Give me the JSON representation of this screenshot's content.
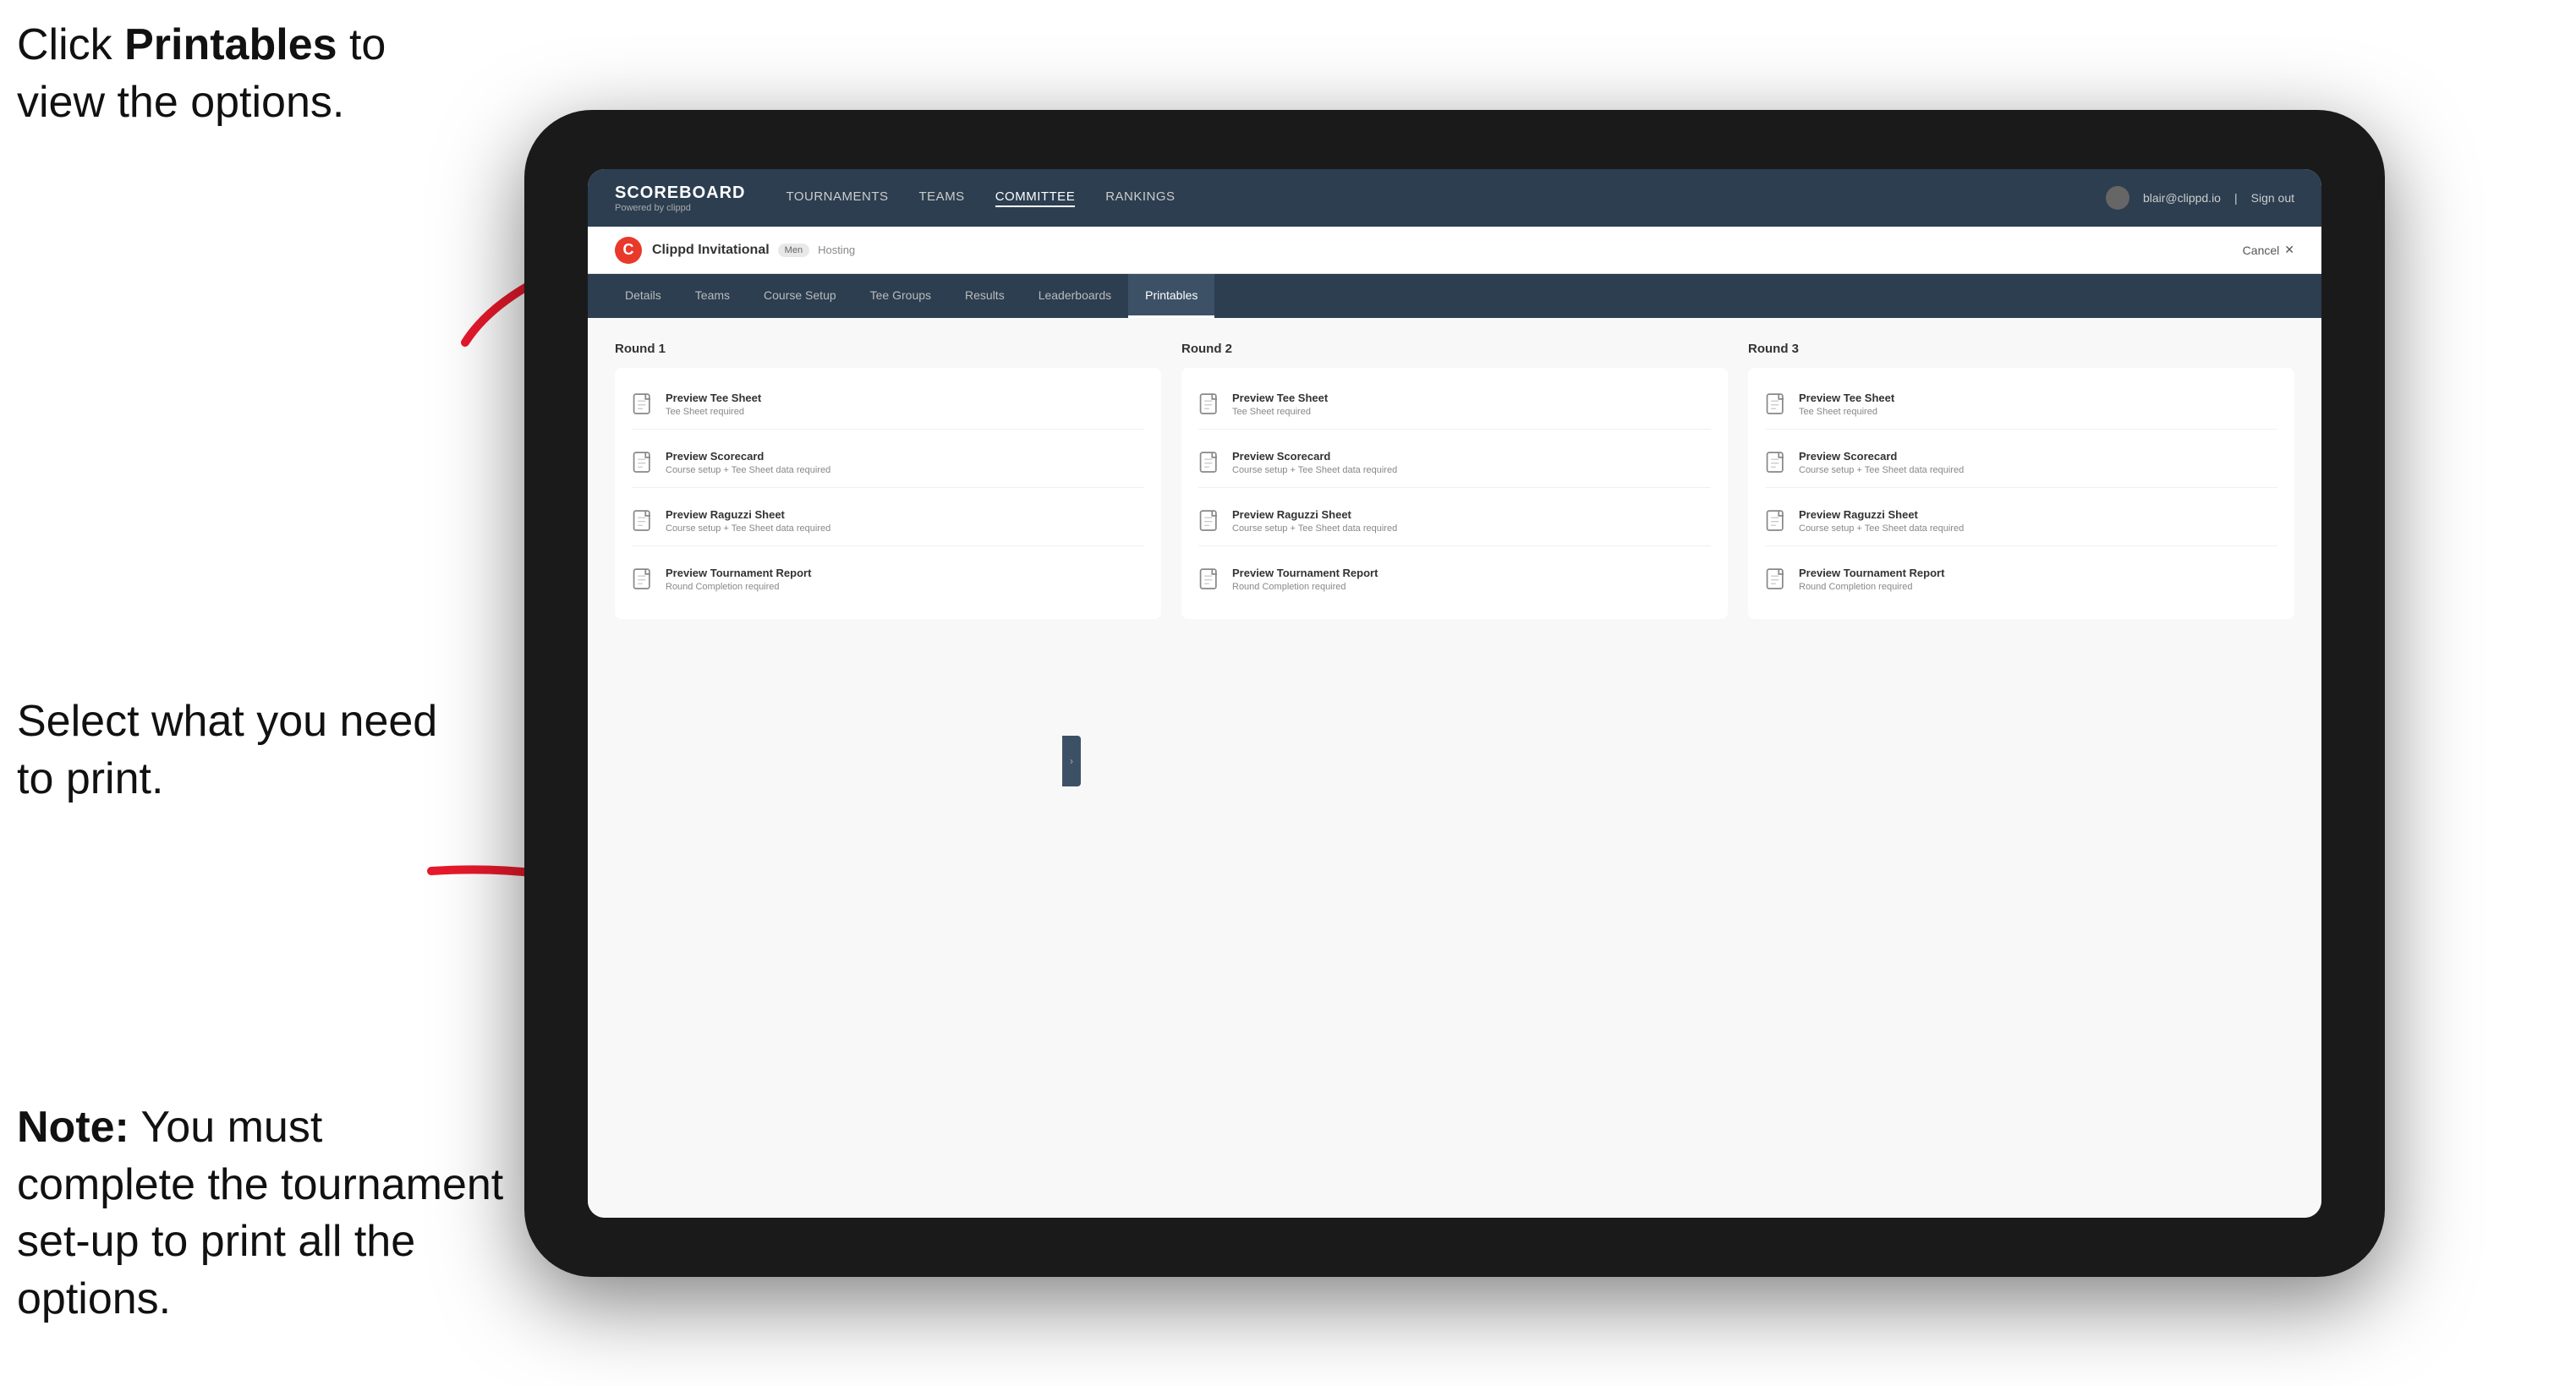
{
  "annotations": {
    "top": "Click Printables to view the options.",
    "top_bold": "Printables",
    "middle": "Select what you need to print.",
    "bottom_note_bold": "Note:",
    "bottom_note": " You must complete the tournament set-up to print all the options."
  },
  "nav": {
    "logo_title": "SCOREBOARD",
    "logo_sub": "Powered by clippd",
    "links": [
      {
        "label": "TOURNAMENTS",
        "active": false
      },
      {
        "label": "TEAMS",
        "active": false
      },
      {
        "label": "COMMITTEE",
        "active": false
      },
      {
        "label": "RANKINGS",
        "active": false
      }
    ],
    "user_email": "blair@clippd.io",
    "sign_out": "Sign out",
    "separator": "|"
  },
  "tournament": {
    "logo_letter": "C",
    "name": "Clippd Invitational",
    "badge": "Men",
    "status": "Hosting",
    "cancel_label": "Cancel"
  },
  "sub_tabs": [
    {
      "label": "Details",
      "active": false
    },
    {
      "label": "Teams",
      "active": false
    },
    {
      "label": "Course Setup",
      "active": false
    },
    {
      "label": "Tee Groups",
      "active": false
    },
    {
      "label": "Results",
      "active": false
    },
    {
      "label": "Leaderboards",
      "active": false
    },
    {
      "label": "Printables",
      "active": true
    }
  ],
  "rounds": [
    {
      "title": "Round 1",
      "items": [
        {
          "label": "Preview Tee Sheet",
          "sub": "Tee Sheet required"
        },
        {
          "label": "Preview Scorecard",
          "sub": "Course setup + Tee Sheet data required"
        },
        {
          "label": "Preview Raguzzi Sheet",
          "sub": "Course setup + Tee Sheet data required"
        },
        {
          "label": "Preview Tournament Report",
          "sub": "Round Completion required"
        }
      ]
    },
    {
      "title": "Round 2",
      "items": [
        {
          "label": "Preview Tee Sheet",
          "sub": "Tee Sheet required"
        },
        {
          "label": "Preview Scorecard",
          "sub": "Course setup + Tee Sheet data required"
        },
        {
          "label": "Preview Raguzzi Sheet",
          "sub": "Course setup + Tee Sheet data required"
        },
        {
          "label": "Preview Tournament Report",
          "sub": "Round Completion required"
        }
      ]
    },
    {
      "title": "Round 3",
      "items": [
        {
          "label": "Preview Tee Sheet",
          "sub": "Tee Sheet required"
        },
        {
          "label": "Preview Scorecard",
          "sub": "Course setup + Tee Sheet data required"
        },
        {
          "label": "Preview Raguzzi Sheet",
          "sub": "Course setup + Tee Sheet data required"
        },
        {
          "label": "Preview Tournament Report",
          "sub": "Round Completion required"
        }
      ]
    }
  ]
}
